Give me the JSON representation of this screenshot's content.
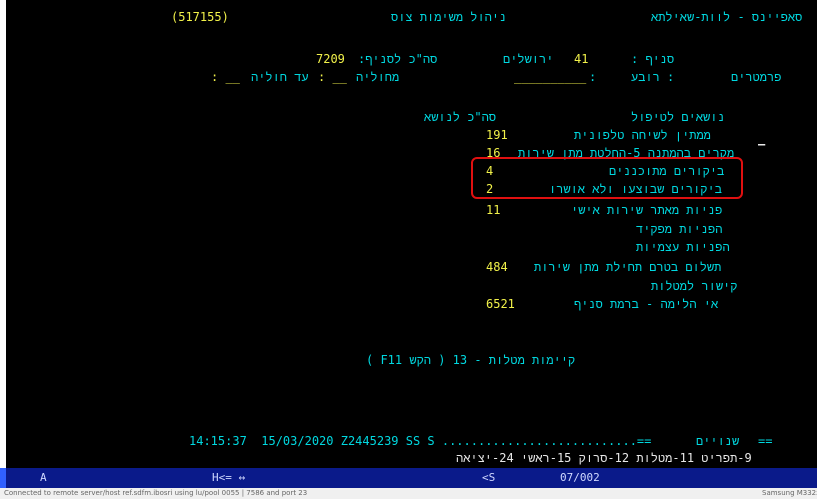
{
  "header": {
    "session_code": "(517155)",
    "screen_title": "ניהול משימות צוס",
    "app_path": "סאפיינס - לוות-שאילתא"
  },
  "branch_row": {
    "branch_label": "סניף :",
    "branch_code": "41",
    "branch_name": "ירושלים",
    "branch_total_label": "סה\"כ לסניף:",
    "branch_total_value": "7209"
  },
  "filter_row": {
    "parameters_label": "פרמטרים",
    "quarter_label": ": רובע",
    "quarter_value": "__________",
    "sep": ":",
    "from_label": "מחוליה",
    "from_value": ": __",
    "to_label": "עד חוליה",
    "to_value": ": __"
  },
  "table": {
    "col_topics": "נושאים לטיפול",
    "col_total": "סה\"כ לנושא",
    "cursor_mark": "–",
    "rows": [
      {
        "label": "ממתין לשיחה טלפונית",
        "value": "191"
      },
      {
        "label": "מקרים בהמתנה 5-החלטת מתן שירות",
        "value": "16"
      },
      {
        "label": "ביקורים מתוכננים",
        "value": "4"
      },
      {
        "label": "ביקורים שבוצעו ולא אושרו",
        "value": "2"
      },
      {
        "label": "פניות מאתר שירות אישי",
        "value": "11"
      },
      {
        "label": "הפניות מפקיד",
        "value": ""
      },
      {
        "label": "הפניות עצמיות",
        "value": ""
      },
      {
        "label": "תשלום בטרם תחילת מתן שירות",
        "value": "484"
      },
      {
        "label": "קישור למטלות",
        "value": ""
      },
      {
        "label": "אי הלימה - ברמת סניף",
        "value": "6521"
      }
    ]
  },
  "existing_tasks": "קיימות מטלות - 13 ( הקש F11 )",
  "status_line": {
    "timestamp": "14:15:37  15/03/2020 Z2445239 SS S ...........................==",
    "changes_label": "שנויים",
    "end_mark": "=="
  },
  "function_keys": "9-תפריט 11-מטלות 12-סרוק 15-ראשי 24-יציאה",
  "emulator_status": {
    "left": "A",
    "mid": "H<= ↔",
    "right_a": "<S",
    "page": "07/002"
  },
  "footer": {
    "connection": "Connected to remote server/host ref.sdfm.ibosri using lu/pool 0055 | 7586 and port 23",
    "right": "Samsung M332x"
  },
  "colors": {
    "terminal_bg": "#000000",
    "text_cyan": "#00d8e0",
    "text_yellow": "#f2f24a",
    "highlight_box": "#e01010",
    "status_bar": "#0a1a8a"
  }
}
